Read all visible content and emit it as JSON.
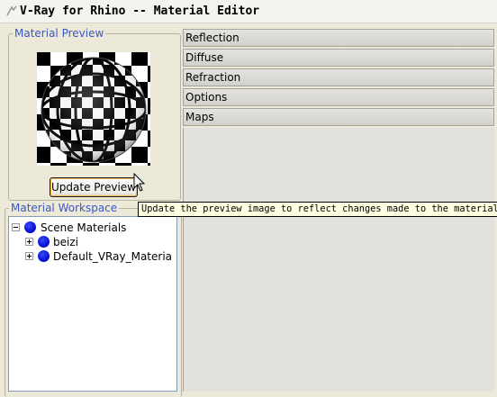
{
  "window": {
    "title": "V-Ray for Rhino -- Material Editor"
  },
  "preview": {
    "group_label": "Material Preview",
    "update_button": "Update Preview",
    "tooltip": "Update the preview image to reflect changes made to the material"
  },
  "workspace": {
    "group_label": "Material Workspace",
    "tree": [
      {
        "label": "Scene Materials",
        "expander": "minus",
        "icon": "blue-sphere-icon"
      },
      {
        "label": "beizi",
        "expander": "plus",
        "icon": "blue-sphere-icon"
      },
      {
        "label": "Default_VRay_Materia",
        "expander": "plus",
        "icon": "blue-sphere-icon"
      }
    ]
  },
  "sections": {
    "items": [
      {
        "label": "Reflection"
      },
      {
        "label": "Diffuse"
      },
      {
        "label": "Refraction"
      },
      {
        "label": "Options"
      },
      {
        "label": "Maps"
      }
    ]
  },
  "colors": {
    "group_label": "#3a57c6",
    "material_dot": "#0b13d8",
    "tooltip_bg": "#ffffe1"
  }
}
